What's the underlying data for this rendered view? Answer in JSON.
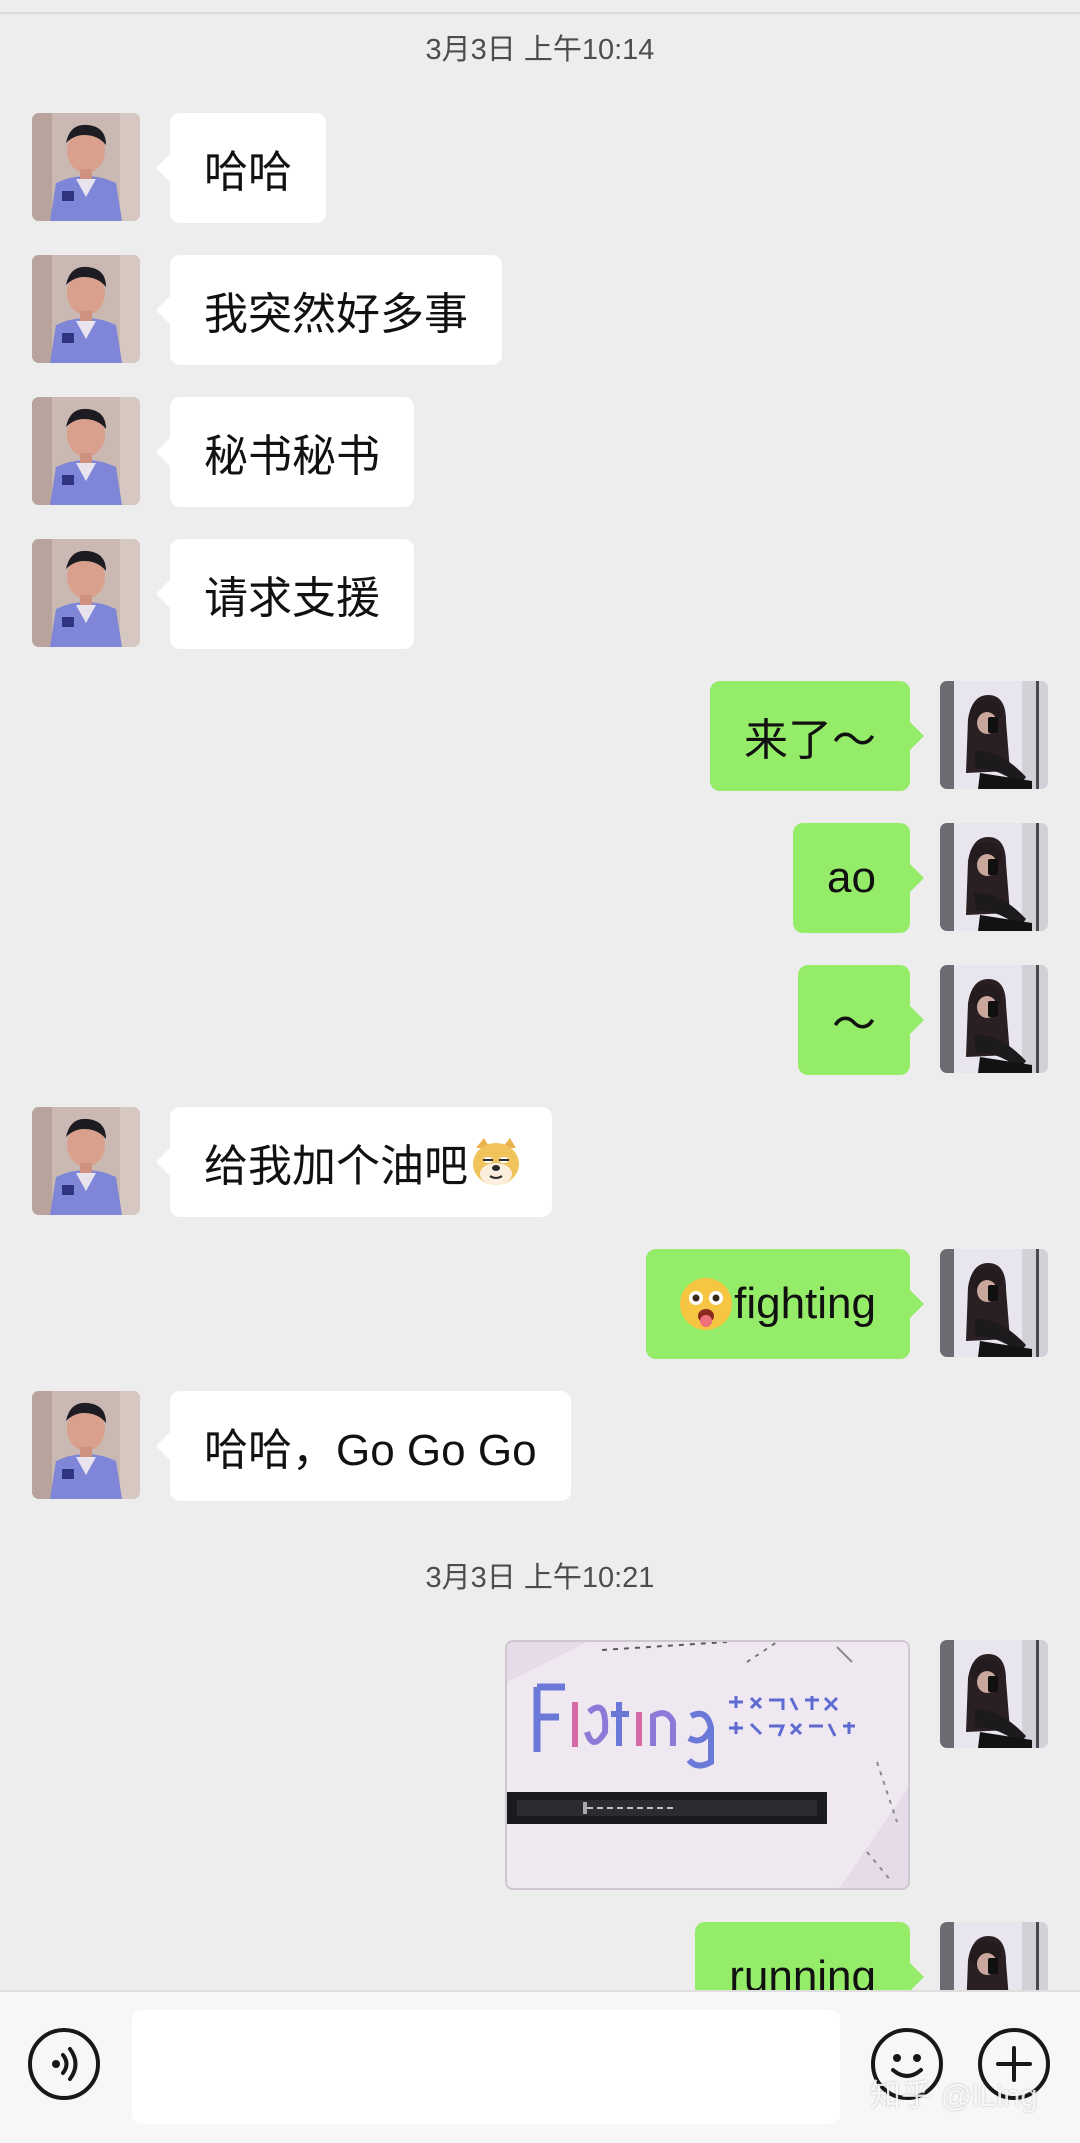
{
  "chat": {
    "timestamps": [
      "3月3日 上午10:14",
      "3月3日 上午10:21"
    ],
    "messages": [
      {
        "side": "left",
        "text": "哈哈"
      },
      {
        "side": "left",
        "text": "我突然好多事"
      },
      {
        "side": "left",
        "text": "秘书秘书"
      },
      {
        "side": "left",
        "text": "请求支援"
      },
      {
        "side": "right",
        "text": "来了～"
      },
      {
        "side": "right",
        "text": "ao"
      },
      {
        "side": "right",
        "text": "～"
      },
      {
        "side": "left",
        "text": "给我加个油吧",
        "emoji": "doge-emoji"
      },
      {
        "side": "right",
        "text": "fighting",
        "emoji": "tongue-out-emoji"
      },
      {
        "side": "left",
        "text": "哈哈，Go Go Go"
      },
      {
        "side": "right",
        "type": "image",
        "image": "photo-fighting-card"
      },
      {
        "side": "right",
        "text": "running"
      }
    ]
  },
  "input_bar": {
    "voice_icon": "voice-icon",
    "emoji_icon": "emoji-icon",
    "add_icon": "plus-icon"
  },
  "watermark": "知乎 @lLing",
  "colors": {
    "background": "#ededed",
    "sent_bubble": "#95ec69",
    "received_bubble": "#ffffff"
  }
}
